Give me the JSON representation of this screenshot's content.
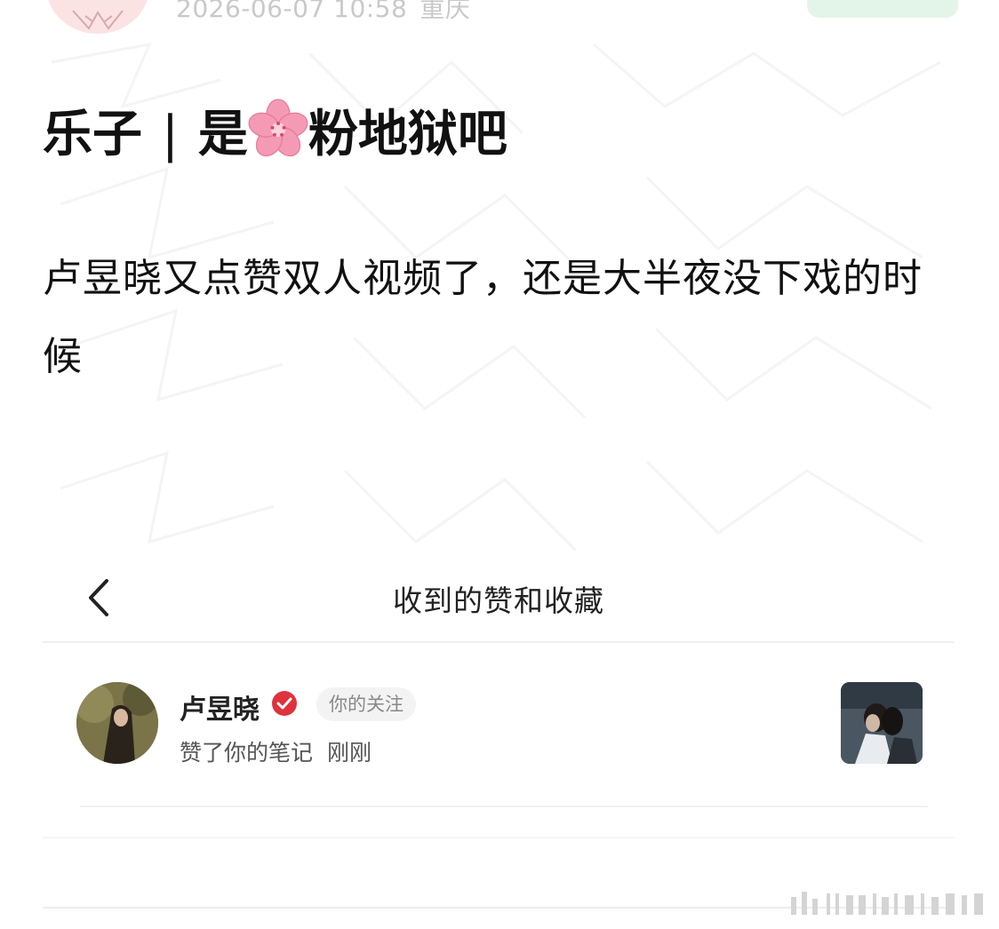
{
  "post": {
    "author_avatar_icon": "user-avatar-icon",
    "meta": {
      "date": "2026-06-07 10:58",
      "location": "重庆"
    },
    "title": {
      "prefix": "乐子",
      "separator": "|",
      "mid": "是",
      "emoji_icon": "cherry-blossom-icon",
      "suffix": "粉地狱吧"
    },
    "body": "卢昱晓又点赞双人视频了，还是大半夜没下戏的时候"
  },
  "screenshot": {
    "nav": {
      "back_icon": "chevron-left-icon",
      "title": "收到的赞和收藏"
    },
    "notification": {
      "user_name": "卢昱晓",
      "verified_icon": "verified-badge-icon",
      "follow_tag": "你的关注",
      "action": "赞了你的笔记",
      "time": "刚刚",
      "thumbnail_icon": "note-thumbnail-icon"
    }
  },
  "colors": {
    "text": "#111111",
    "meta_text": "#c9c9c9",
    "accent_green_pill": "#e3f5e8",
    "verified_red": "#e0323c",
    "blossom_pink": "#f59ab5"
  }
}
